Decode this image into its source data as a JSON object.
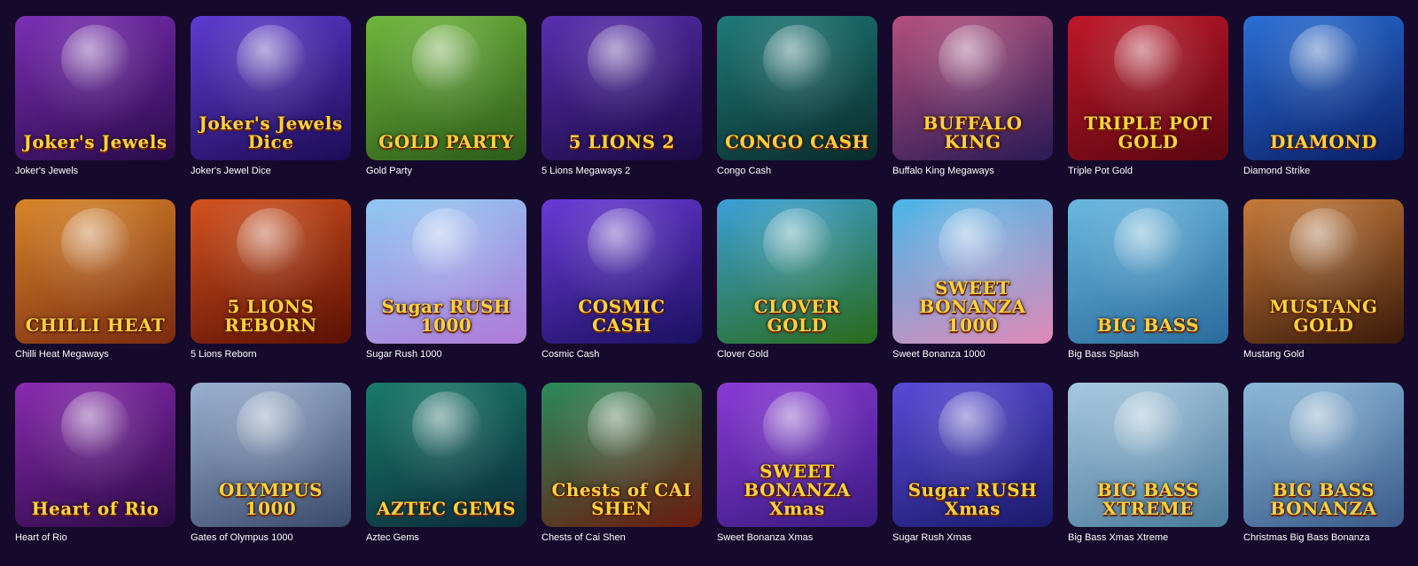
{
  "games": [
    {
      "title": "Joker's Jewels",
      "logo": "Joker's Jewels",
      "colors": [
        "#7b2fb5",
        "#2a0a4a"
      ]
    },
    {
      "title": "Joker's Jewel Dice",
      "logo": "Joker's Jewels Dice",
      "colors": [
        "#5d3bd1",
        "#1c0c55"
      ]
    },
    {
      "title": "Gold Party",
      "logo": "GOLD PARTY",
      "colors": [
        "#6fb63c",
        "#2d5a1a"
      ]
    },
    {
      "title": "5 Lions Megaways 2",
      "logo": "5 LIONS 2",
      "colors": [
        "#5a2fb0",
        "#1a0a44"
      ]
    },
    {
      "title": "Congo Cash",
      "logo": "CONGO CASH",
      "colors": [
        "#1f7a7a",
        "#0a2a2a"
      ]
    },
    {
      "title": "Buffalo King Megaways",
      "logo": "BUFFALO KING",
      "colors": [
        "#b5507d",
        "#2a1a55"
      ]
    },
    {
      "title": "Triple Pot Gold",
      "logo": "TRIPLE POT GOLD",
      "colors": [
        "#c0182a",
        "#5a0610"
      ]
    },
    {
      "title": "Diamond Strike",
      "logo": "DIAMOND",
      "colors": [
        "#2b6fd6",
        "#0a1f66"
      ]
    },
    {
      "title": "Chilli Heat Megaways",
      "logo": "CHILLI HEAT",
      "colors": [
        "#d8862a",
        "#7a2a10"
      ]
    },
    {
      "title": "5 Lions Reborn",
      "logo": "5 LIONS REBORN",
      "colors": [
        "#d4521e",
        "#5a1004"
      ]
    },
    {
      "title": "Sugar Rush 1000",
      "logo": "Sugar RUSH 1000",
      "colors": [
        "#8fc8f2",
        "#b07ad8"
      ]
    },
    {
      "title": "Cosmic Cash",
      "logo": "COSMIC CASH",
      "colors": [
        "#6a3ad6",
        "#1a1060"
      ]
    },
    {
      "title": "Clover Gold",
      "logo": "CLOVER GOLD",
      "colors": [
        "#3aa0d8",
        "#2a6a1a"
      ]
    },
    {
      "title": "Sweet Bonanza 1000",
      "logo": "SWEET BONANZA 1000",
      "colors": [
        "#4ab6e8",
        "#e08ab8"
      ]
    },
    {
      "title": "Big Bass Splash",
      "logo": "BIG BASS",
      "colors": [
        "#6ab8e0",
        "#2a6a9a"
      ]
    },
    {
      "title": "Mustang Gold",
      "logo": "MUSTANG GOLD",
      "colors": [
        "#c77a3a",
        "#3a1a0a"
      ]
    },
    {
      "title": "Heart of Rio",
      "logo": "Heart of Rio",
      "colors": [
        "#8a2ab0",
        "#2a0a44"
      ]
    },
    {
      "title": "Gates of Olympus 1000",
      "logo": "OLYMPUS 1000",
      "colors": [
        "#9ab0d0",
        "#3a4a6a"
      ]
    },
    {
      "title": "Aztec Gems",
      "logo": "AZTEC GEMS",
      "colors": [
        "#1a7a6a",
        "#0a2a3a"
      ]
    },
    {
      "title": "Chests of Cai Shen",
      "logo": "Chests of CAI SHEN",
      "colors": [
        "#2a8a5a",
        "#6a1a10"
      ]
    },
    {
      "title": "Sweet Bonanza Xmas",
      "logo": "SWEET BONANZA Xmas",
      "colors": [
        "#8a3ad6",
        "#3a1a80"
      ]
    },
    {
      "title": "Sugar Rush Xmas",
      "logo": "Sugar RUSH Xmas",
      "colors": [
        "#5a4ad8",
        "#1a1a6a"
      ]
    },
    {
      "title": "Big Bass Xmas Xtreme",
      "logo": "BIG BASS XTREME",
      "colors": [
        "#a8c8e0",
        "#4a7a9a"
      ]
    },
    {
      "title": "Christmas Big Bass Bonanza",
      "logo": "BIG BASS BONANZA",
      "colors": [
        "#8ab8d8",
        "#3a5a8a"
      ]
    }
  ]
}
